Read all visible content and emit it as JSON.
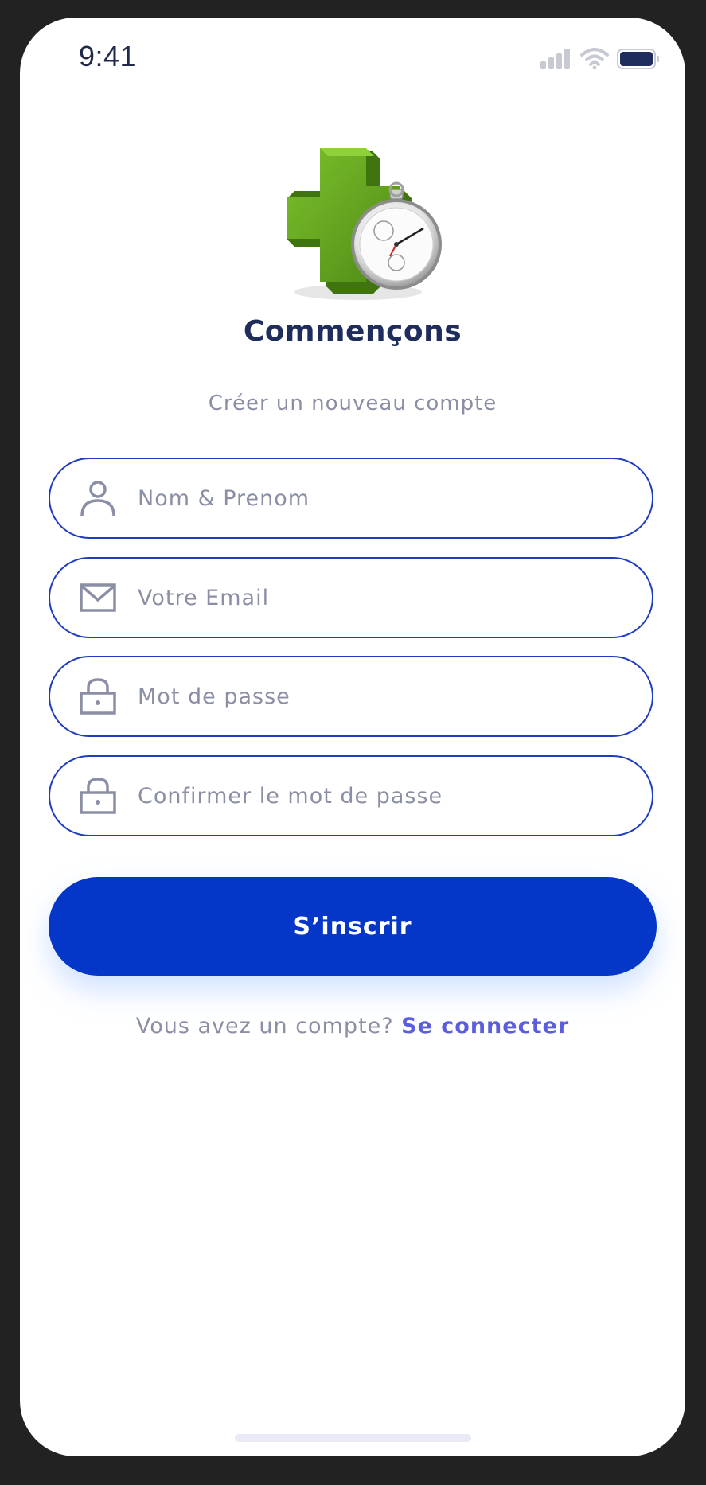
{
  "status_bar": {
    "time": "9:41",
    "icons": [
      "cellular-signal-icon",
      "wifi-icon",
      "battery-icon"
    ]
  },
  "logo": {
    "icon": "green-cross-stopwatch-logo"
  },
  "header": {
    "title": "Commençons",
    "subtitle": "Créer un nouveau compte"
  },
  "form": {
    "fields": [
      {
        "icon": "person-icon",
        "placeholder": "Nom & Prenom",
        "value": ""
      },
      {
        "icon": "mail-icon",
        "placeholder": "Votre Email",
        "value": ""
      },
      {
        "icon": "lock-icon",
        "placeholder": "Mot de passe",
        "value": ""
      },
      {
        "icon": "lock-icon",
        "placeholder": "Confirmer le mot de passe",
        "value": ""
      }
    ],
    "submit_label": "S’inscrir"
  },
  "footer": {
    "prompt": "Vous avez un compte?",
    "link_label": "Se connecter"
  },
  "colors": {
    "primary": "#0436c8",
    "field_border": "#1f3cc0",
    "title": "#1e2d5c",
    "muted_text": "#8b8fa5",
    "link": "#5a5de0",
    "logo_green": "#5a9b1c"
  }
}
